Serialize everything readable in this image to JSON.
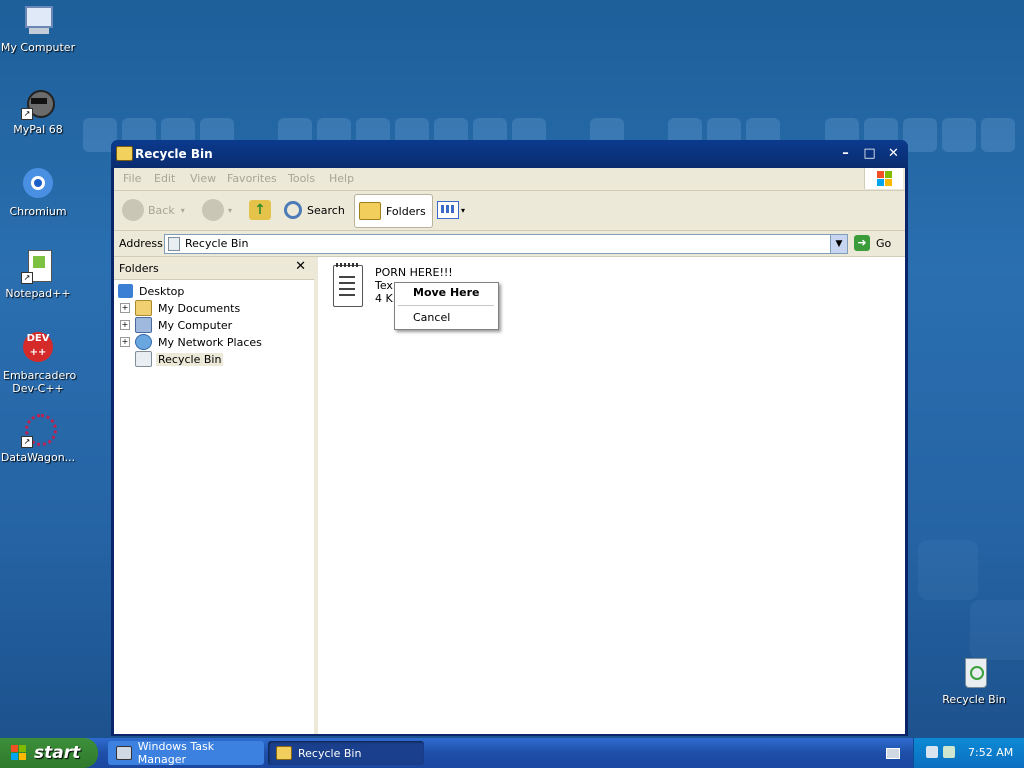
{
  "desktop": {
    "icons": [
      {
        "label": "My Computer"
      },
      {
        "label": "MyPal 68"
      },
      {
        "label": "Chromium"
      },
      {
        "label": "Notepad++"
      },
      {
        "label": "Embarcadero Dev-C++"
      },
      {
        "label": "DataWagon..."
      },
      {
        "label": "Recycle Bin"
      }
    ]
  },
  "window": {
    "title": "Recycle Bin",
    "menu": [
      "File",
      "Edit",
      "View",
      "Favorites",
      "Tools",
      "Help"
    ],
    "toolbar": {
      "back": "Back",
      "search": "Search",
      "folders": "Folders"
    },
    "address": {
      "label": "Address",
      "value": "Recycle Bin",
      "go": "Go"
    },
    "folders_pane": {
      "title": "Folders",
      "tree": [
        {
          "label": "Desktop",
          "expander": ""
        },
        {
          "label": "My Documents",
          "expander": "+"
        },
        {
          "label": "My Computer",
          "expander": "+"
        },
        {
          "label": "My Network Places",
          "expander": "+"
        },
        {
          "label": "Recycle Bin",
          "expander": ""
        }
      ]
    },
    "file": {
      "name": "PORN HERE!!!",
      "type": "Tex",
      "size": "4 K"
    },
    "context_menu": {
      "items": [
        "Move Here",
        "Cancel"
      ]
    }
  },
  "taskbar": {
    "start": "start",
    "tasks": [
      "Windows Task Manager",
      "Recycle Bin"
    ],
    "clock": "7:52 AM"
  },
  "colors": {
    "titlebar": "#0a246a",
    "taskbar": "#1e4fa8",
    "start": "#2e7a2c",
    "window_bg": "#ece9d8"
  }
}
